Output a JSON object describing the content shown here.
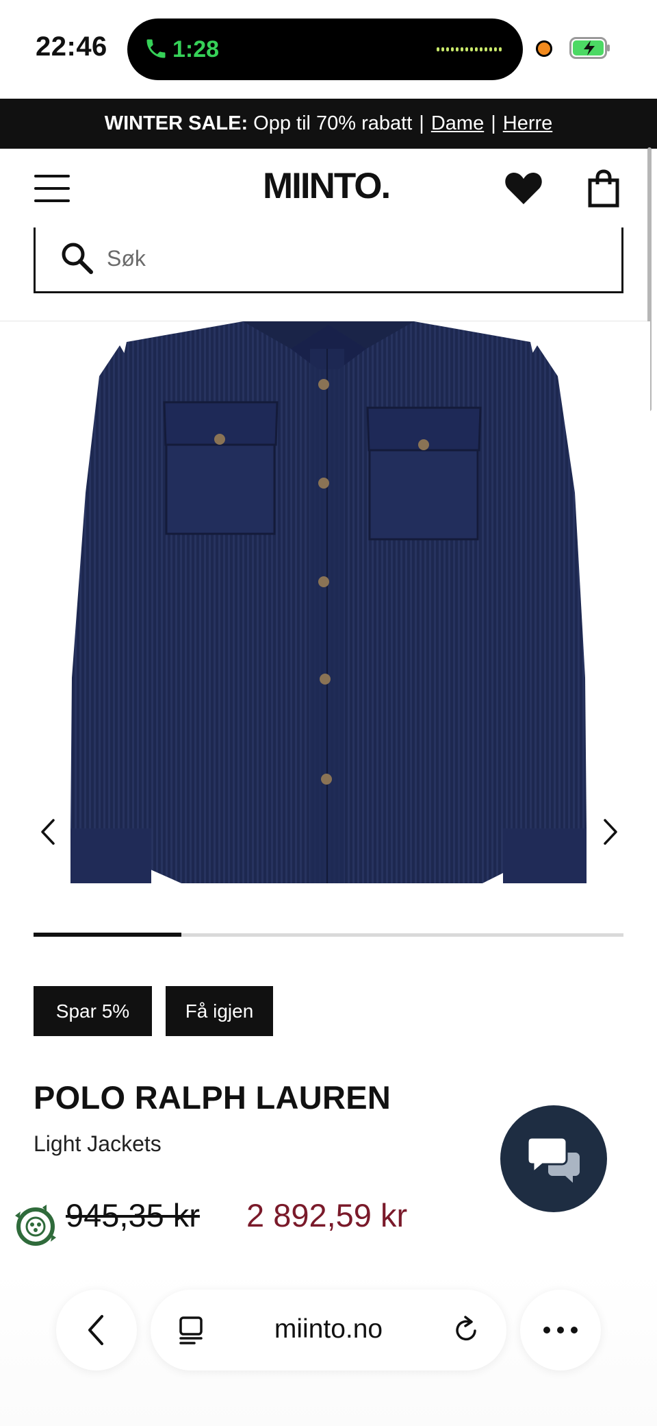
{
  "status_bar": {
    "time": "22:46",
    "call_time": "1:28"
  },
  "announcement": {
    "prefix": "WINTER SALE:",
    "text": "Opp til 70% rabatt",
    "link_women": "Dame",
    "link_men": "Herre"
  },
  "header": {
    "logo": "MIINTO.",
    "menu_icon": "hamburger-menu-icon",
    "wishlist_icon": "heart-icon",
    "cart_icon": "shopping-bag-icon"
  },
  "search": {
    "placeholder": "Søk",
    "value": ""
  },
  "gallery": {
    "image_description": "Navy corduroy shirt jacket",
    "prev_icon": "chevron-left-icon",
    "next_icon": "chevron-right-icon",
    "progress": 0.25
  },
  "badges": {
    "discount": "Spar 5%",
    "resale": "Få igjen"
  },
  "product": {
    "brand": "POLO RALPH LAUREN",
    "category": "Light Jackets",
    "old_price": "945,35 kr",
    "new_price": "2 892,59 kr"
  },
  "colors": {
    "sale_price": "#7a1a2a",
    "chat_button": "#1e2d42",
    "announcement_bg": "#111111",
    "call_green": "#36d158"
  },
  "browser": {
    "url": "miinto.no",
    "back_icon": "chevron-left-icon",
    "tabs_icon": "tab-overview-icon",
    "reload_icon": "reload-icon",
    "more_icon": "more-dots-icon"
  }
}
